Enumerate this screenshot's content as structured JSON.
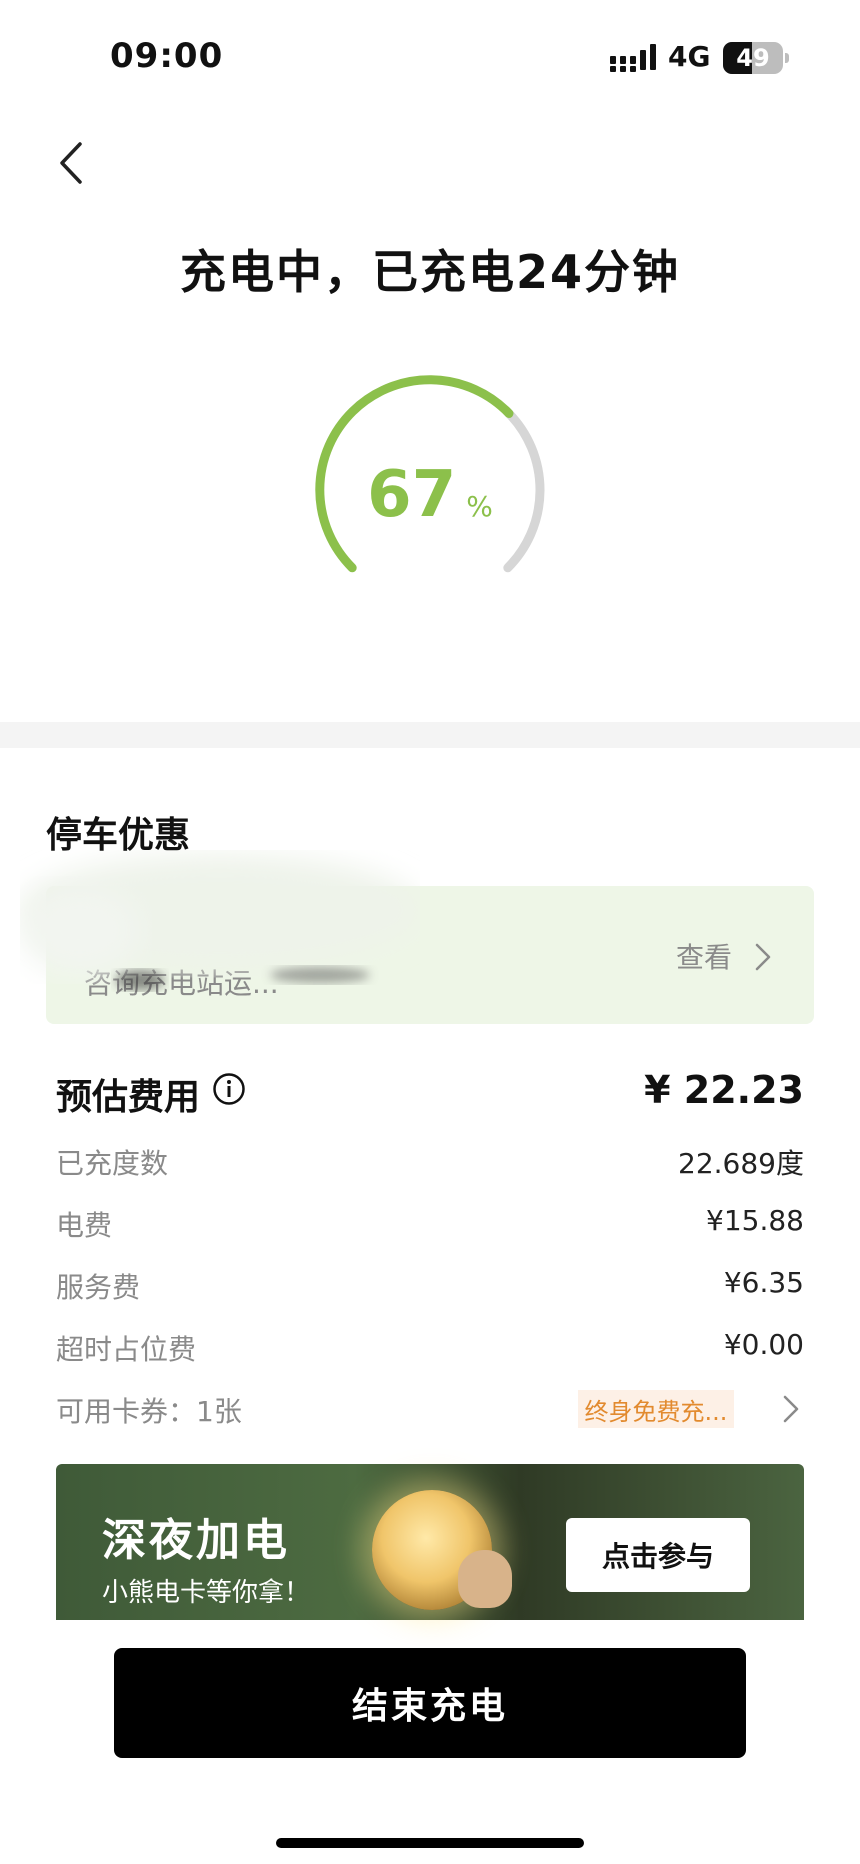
{
  "status_bar": {
    "time": "09:00",
    "network": "4G",
    "battery": "49",
    "battery_level": 0.49
  },
  "header": {
    "title": "充电中，已充电24分钟"
  },
  "gauge": {
    "value": "67",
    "unit": "%",
    "progress": 0.67,
    "color_active": "#8cc04b",
    "color_track": "#d6d6d6"
  },
  "parking": {
    "title": "停车优惠",
    "text": "咨询充电站运...",
    "view_label": "查看"
  },
  "cost": {
    "title": "预估费用",
    "total": "¥ 22.23",
    "rows": [
      {
        "label": "已充度数",
        "value": "22.689度"
      },
      {
        "label": "电费",
        "value": "¥15.88"
      },
      {
        "label": "服务费",
        "value": "¥6.35"
      },
      {
        "label": "超时占位费",
        "value": "¥0.00"
      }
    ],
    "coupon_label": "可用卡券：1张",
    "coupon_badge": "终身免费充..."
  },
  "banner": {
    "title": "深夜加电",
    "subtitle": "小熊电卡等你拿！",
    "button": "点击参与"
  },
  "actions": {
    "end_charging": "结束充电"
  },
  "icons": [
    "back-chevron-icon",
    "info-icon",
    "chevron-right-icon",
    "signal-icon",
    "battery-icon"
  ]
}
